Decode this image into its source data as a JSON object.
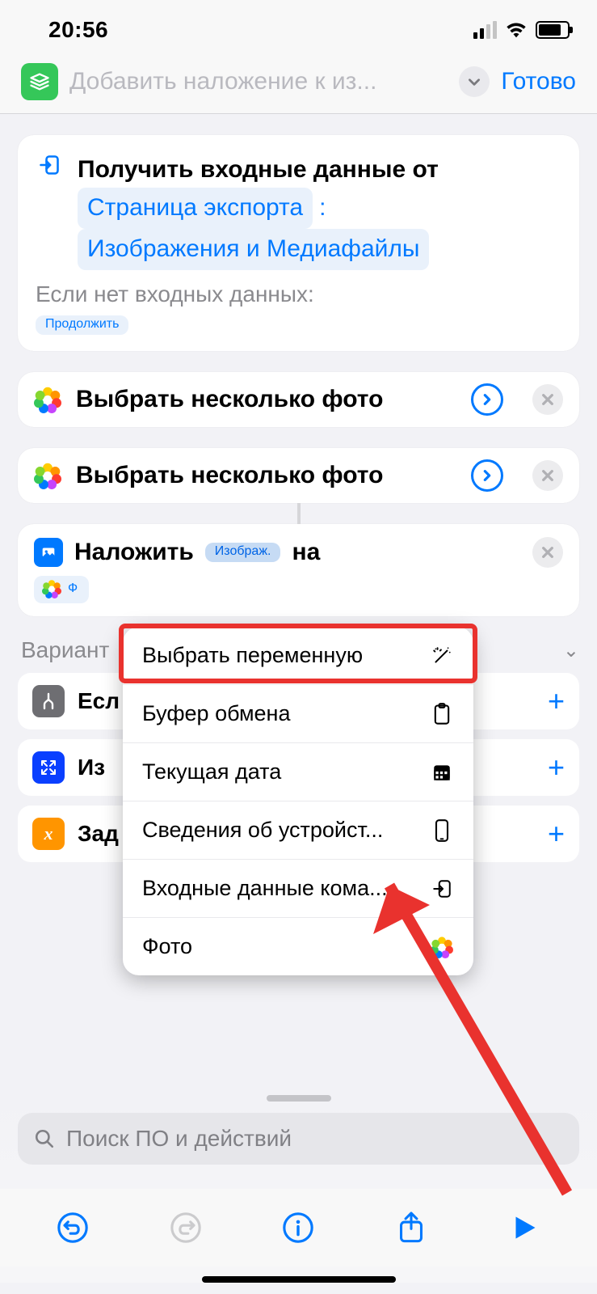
{
  "status": {
    "time": "20:56"
  },
  "nav": {
    "title": "Добавить наложение к из...",
    "done": "Готово"
  },
  "action_input": {
    "prefix": "Получить входные данные от",
    "token1": "Страница экспорта",
    "token2": "Изображения и Медиафайлы",
    "fallback_label": "Если нет входных данных:",
    "fallback_token": "Продолжить"
  },
  "select_photos": {
    "label": "Выбрать несколько фото"
  },
  "overlay": {
    "word1": "Наложить",
    "image_token": "Изображ.",
    "word2": "на",
    "photo_token": "Ф"
  },
  "popover": {
    "items": [
      {
        "label": "Выбрать переменную",
        "icon": "magic"
      },
      {
        "label": "Буфер обмена",
        "icon": "clipboard"
      },
      {
        "label": "Текущая дата",
        "icon": "calendar"
      },
      {
        "label": "Сведения об устройст...",
        "icon": "device"
      },
      {
        "label": "Входные данные кома...",
        "icon": "input"
      },
      {
        "label": "Фото",
        "icon": "photos"
      }
    ]
  },
  "suggestions": {
    "header": "Вариант",
    "items": [
      {
        "label": "Есл",
        "color": "#6e6e72"
      },
      {
        "label": "Из",
        "color": "#0a3fff"
      },
      {
        "label": "Зад",
        "color": "#ff9500"
      }
    ]
  },
  "search": {
    "placeholder": "Поиск ПО и действий"
  }
}
